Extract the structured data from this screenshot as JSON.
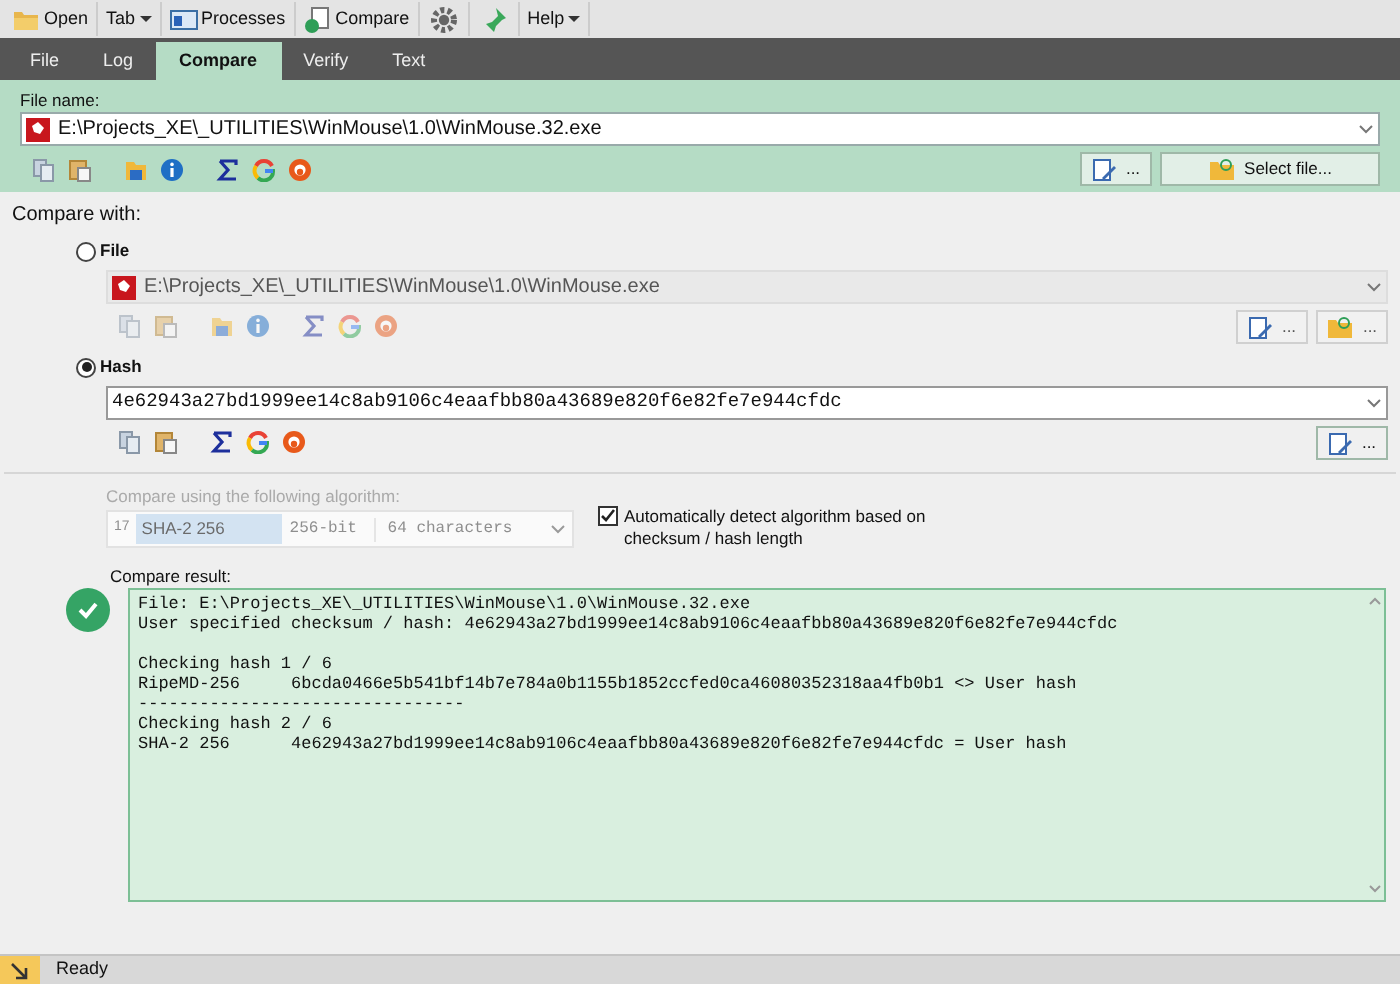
{
  "toolbar": [
    {
      "label": "Open",
      "menu": false
    },
    {
      "label": "Tab",
      "menu": true
    },
    {
      "label": "Processes",
      "menu": false
    },
    {
      "label": "Compare",
      "menu": false
    },
    {
      "label": "Help",
      "menu": true
    }
  ],
  "tabs": [
    {
      "label": "File",
      "selected": false
    },
    {
      "label": "Log",
      "selected": false
    },
    {
      "label": "Compare",
      "selected": true
    },
    {
      "label": "Verify",
      "selected": false
    },
    {
      "label": "Text",
      "selected": false
    }
  ],
  "file_name": {
    "label": "File name:",
    "value": "E:\\Projects_XE\\_UTILITIES\\WinMouse\\1.0\\WinMouse.32.exe",
    "edit_button": "...",
    "select_button": "Select file..."
  },
  "compare_with": {
    "label": "Compare with:",
    "options": [
      {
        "kind": "file",
        "label": "File",
        "selected": false,
        "value": "E:\\Projects_XE\\_UTILITIES\\WinMouse\\1.0\\WinMouse.exe",
        "buttons": [
          "...",
          "..."
        ]
      },
      {
        "kind": "hash",
        "label": "Hash",
        "selected": true,
        "value": "4e62943a27bd1999ee14c8ab9106c4eaafbb80a43689e820f6e82fe7e944cfdc",
        "buttons": [
          "..."
        ]
      }
    ]
  },
  "algorithm": {
    "label": "Compare using the following algorithm:",
    "disabled": true,
    "number": "17",
    "name": "SHA-2 256",
    "bits": "256-bit",
    "length": "64 characters"
  },
  "auto_detect": {
    "label": "Automatically detect algorithm based on checksum / hash length",
    "checked": true
  },
  "result": {
    "label": "Compare result:",
    "matched": true,
    "text": "File: E:\\Projects_XE\\_UTILITIES\\WinMouse\\1.0\\WinMouse.32.exe\nUser specified checksum / hash: 4e62943a27bd1999ee14c8ab9106c4eaafbb80a43689e820f6e82fe7e944cfdc\n\nChecking hash 1 / 6\nRipeMD-256     6bcda0466e5b541bf14b7e784a0b1155b1852ccfed0ca46080352318aa4fb0b1 <> User hash\n--------------------------------\nChecking hash 2 / 6\nSHA-2 256      4e62943a27bd1999ee14c8ab9106c4eaafbb80a43689e820f6e82fe7e944cfdc = User hash"
  },
  "status_bar": {
    "text": "Ready"
  }
}
